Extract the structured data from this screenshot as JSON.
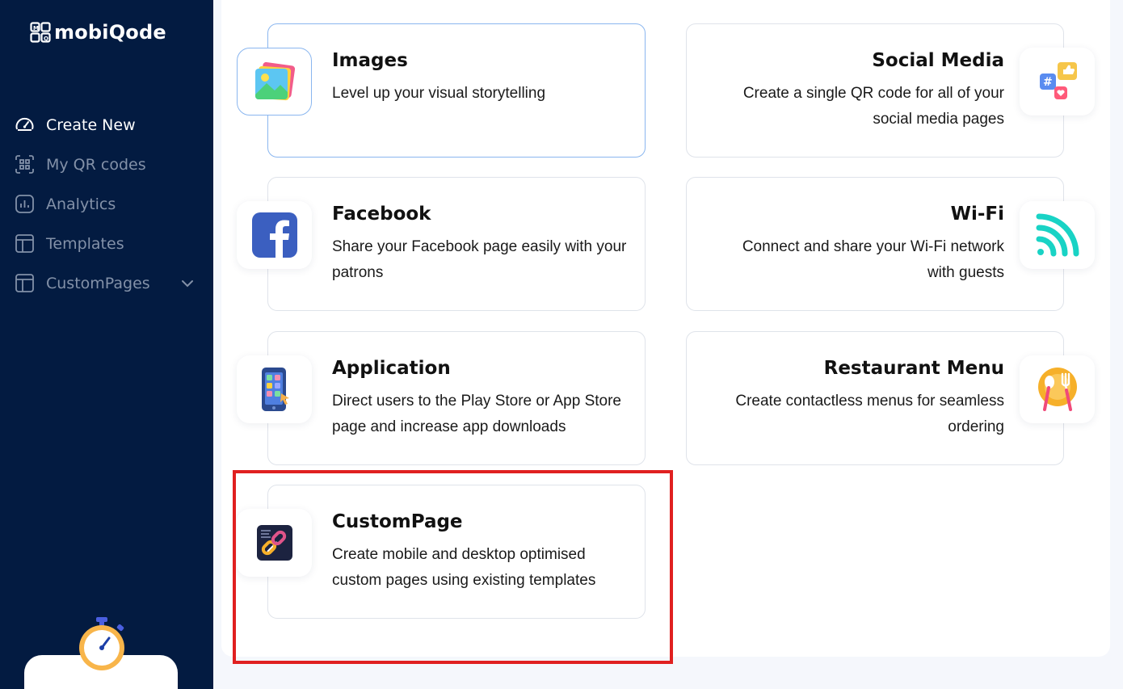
{
  "app": {
    "brand": "mobiQode"
  },
  "sidebar": {
    "items": [
      {
        "label": "Create New",
        "icon": "speedometer-icon",
        "active": true
      },
      {
        "label": "My QR codes",
        "icon": "qr-scan-icon",
        "active": false
      },
      {
        "label": "Analytics",
        "icon": "analytics-icon",
        "active": false
      },
      {
        "label": "Templates",
        "icon": "layout-template-icon",
        "active": false
      },
      {
        "label": "CustomPages",
        "icon": "layout-template-icon",
        "active": false,
        "has_dropdown": true
      }
    ]
  },
  "cards": [
    {
      "title": "Images",
      "desc": "Level up your visual storytelling",
      "icon": "images-icon",
      "selected": true
    },
    {
      "title": "Social Media",
      "desc": "Create a single QR code for all of your social media pages",
      "icon": "social-media-icon"
    },
    {
      "title": "Facebook",
      "desc": "Share your Facebook page easily with your patrons",
      "icon": "facebook-icon"
    },
    {
      "title": "Wi-Fi",
      "desc": "Connect and share your Wi-Fi network with guests",
      "icon": "wifi-icon"
    },
    {
      "title": "Application",
      "desc": "Direct users to the Play Store or App Store page and increase app downloads",
      "icon": "smartphone-app-icon"
    },
    {
      "title": "Restaurant Menu",
      "desc": "Create contactless menus for seamless ordering",
      "icon": "restaurant-plate-icon"
    },
    {
      "title": "CustomPage",
      "desc": "Create mobile and desktop optimised custom pages using existing templates",
      "icon": "custom-page-link-icon",
      "highlighted": true
    }
  ],
  "colors": {
    "sidebar_bg": "#031b41",
    "highlight": "#e02020",
    "selected_border": "#8ab6ef",
    "wifi": "#19d3c5"
  }
}
